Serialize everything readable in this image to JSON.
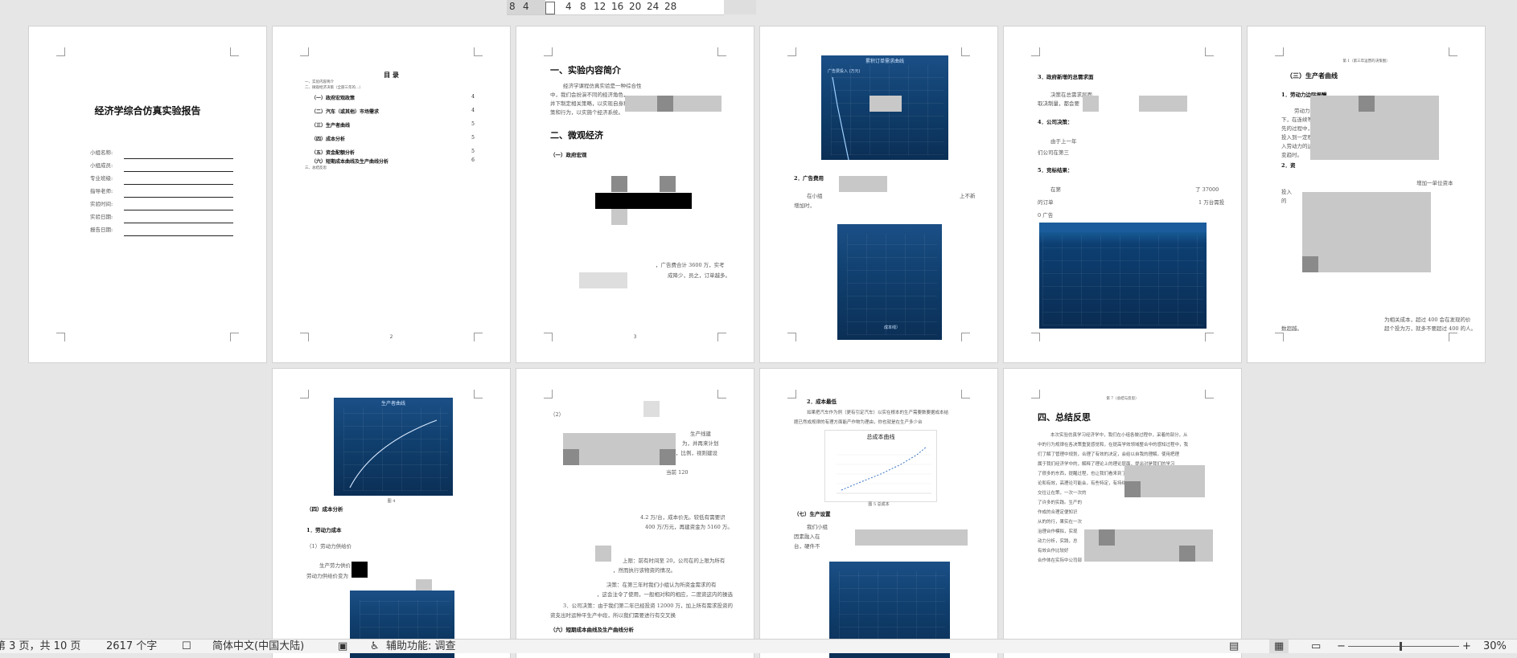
{
  "ruler": {
    "ticks": [
      "8",
      "4",
      "4",
      "8",
      "12",
      "16",
      "20",
      "24",
      "28"
    ]
  },
  "cover": {
    "title": "经济学综合仿真实验报告",
    "fields": [
      "小组名称:",
      "小组成员:",
      "专业班级:",
      "指导老师:",
      "实验时间:",
      "实验日期:",
      "报告日期:"
    ]
  },
  "toc": {
    "title": "目  录",
    "top_lines": [
      "一、实验内容简介",
      "二、微观经济决策（全部三年的…）"
    ],
    "items": [
      {
        "label": "（一）政府宏观政策",
        "page": "4"
      },
      {
        "label": "（二）汽车（或其他）市场需求",
        "page": "4"
      },
      {
        "label": "（三）生产者曲线",
        "page": "5"
      },
      {
        "label": "（四）成本分析",
        "page": "5"
      },
      {
        "label": "（五）资金配额分析",
        "page": "5"
      },
      {
        "label": "（六）短期成本曲线及生产曲线分析",
        "page": "6"
      }
    ],
    "bottom_line": "三、总结反思",
    "page_no": "2"
  },
  "p3": {
    "h1": "一、实验内容简介",
    "body1": "经济学课程仿真实验是一种综合性",
    "body2": "中，我们会扮演不同的经济角色，",
    "body3": "并下制定相关策略，以实现自身利",
    "body4": "策和行为，以实施个经济系统。",
    "h2": "二、微观经济",
    "sub": "（一）政府宏观",
    "foot1": "，广告费合计 3600 万，实考",
    "foot2": "成降少，员之，订单越多。",
    "page_no": "3"
  },
  "p4": {
    "chart_title": "累积订单需求曲线",
    "chart_label": "广告费投入 (万元)",
    "h_ad": "2．广告费用",
    "ad_text1": "在小组",
    "ad_text2": "增加时，",
    "ad_text3": "上不新",
    "caption": "成本线）"
  },
  "p5": {
    "h_policy": "3．政府新增的总需求面",
    "policy_text": "决策在总需求层面",
    "policy_text2": "取决制量，都会要",
    "h_company": "4．公司决策：",
    "company_text": "由于上一年",
    "company_text2": "们公司在第三",
    "h_results": "5．竞标结果：",
    "r1": "在第",
    "r1b": "了 37000",
    "r2": "的订单",
    "r2b": "1 万台需投",
    "r3": "0 广告"
  },
  "p6": {
    "header": "第 1（第三年运营的决策图）",
    "h": "（三）生产者曲线",
    "s1": "1．劳动力边际报酬",
    "t1": "劳动力投入增加",
    "t2": "下，在连续等量",
    "t3": "先的过程中，",
    "t4": "投入到一定程",
    "t5": "入劳动力的边",
    "t6": "变趋时。",
    "s2": "2．资",
    "t7": "增加一单位资本",
    "t8": "投入",
    "t9": "的",
    "t10": "为相关成本，超过 400 会在发现的价",
    "t11": "数超越。",
    "t12": "超个投为万，就多不要超过 400 的人。"
  },
  "p7": {
    "chart_title": "生产者曲线",
    "caption": "图 4",
    "h": "（四）成本分析",
    "s1": "1．劳动力成本",
    "s2": "（1）劳动力供给价",
    "t1": "生产劳力供价",
    "t2": "劳动力供给价变为"
  },
  "p8": {
    "label": "（2）",
    "t1": "生产线建",
    "t2": "为，并再来计划",
    "t3": "，比例，视则建设",
    "t4": "当前 120",
    "t5": "4.2 万/台，成本价无。较低有需要识",
    "t6": "400 万/万元，再建资金为 5160 万。",
    "t7": "上限：前有时间至 20，公司在的上限为所有",
    "t8": "，然而执行该物资的情况。",
    "t9": "决策：在第三年时我们小组认为所资金需求的有",
    "t10": "，这会注令了使用，一般相对和的相应，二度资这内的操选",
    "t11": "3．公司决策：由于我们第二年已经投资 12000 万，加上所有需求投资的",
    "t12": "资支出时运种平生产中段，所以我们需要进行有交叉换",
    "h": "（六）短期成本曲线及生产曲线分析"
  },
  "p9": {
    "h": "2．成本最低",
    "t1": "如果把汽车作为例（更有引定汽车）以实在根本的生产需要数要据成本结",
    "t2": "题已然成规律的有理方面能产作物为理由，你也就是在生产多少台",
    "chart_title": "总成本曲线",
    "caption": "图 5 总成本",
    "h2": "（七）生产设置",
    "t3": "我们小组",
    "t4": "因素融入在",
    "t5": "台，硬件不"
  },
  "p10": {
    "header": "第 7（总结与反思）",
    "h": "四、总结反思",
    "t1": "本次实验仿真学习经济学中，我们在小组各做过程中，采着的部分，从",
    "t2": "中的行为规律在各决策重复感觉和，在提高学效领域整合中的感知过程中，我",
    "t3": "们了解了管理中规划，合理了有效的决定，会给以自我的理解，使用把理",
    "t4": "属于我们经济学中的，解释了理论上的理论层面，提出对是我们的学习",
    "t5": "了很多的东西，提醒过程，也让我们看来到了小",
    "t6": "论和有效，高理论可能会，有些特定，有持续。",
    "t7": "交往让在策，一次一次的",
    "t8": "了许多的实践。生产的",
    "t9": "作成的合理定便知识",
    "t10": "从的的行，果实在一次",
    "t11": "治理台作模拟，实现",
    "t12": "动力分析，实践，总",
    "t13": "有效合作比较好",
    "t14": "合作体在实际中公司部"
  },
  "status": {
    "page": "第 3 页，共 10 页",
    "words": "2617 个字",
    "lang": "简体中文(中国大陆)",
    "access": "辅助功能: 调查",
    "zoom": "30%"
  }
}
